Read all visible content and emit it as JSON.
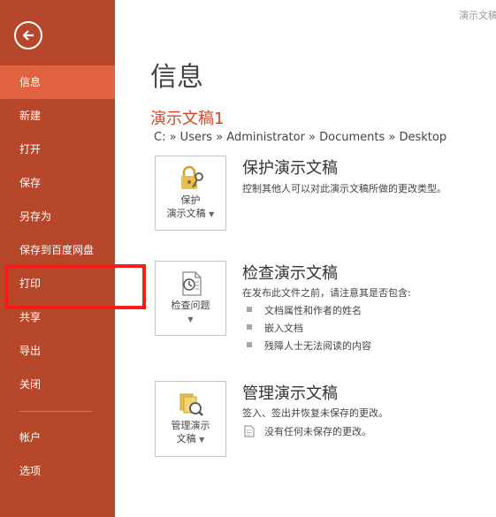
{
  "window": {
    "corner_title": "演示文稿"
  },
  "sidebar": {
    "items": [
      {
        "label": "信息",
        "active": true
      },
      {
        "label": "新建"
      },
      {
        "label": "打开"
      },
      {
        "label": "保存"
      },
      {
        "label": "另存为"
      },
      {
        "label": "保存到百度网盘"
      },
      {
        "label": "打印"
      },
      {
        "label": "共享"
      },
      {
        "label": "导出"
      },
      {
        "label": "关闭"
      },
      {
        "label": "帐户"
      },
      {
        "label": "选项"
      }
    ]
  },
  "main": {
    "page_title": "信息",
    "doc_title": "演示文稿1",
    "path": "C: » Users » Administrator » Documents » Desktop",
    "protect": {
      "tile_line1": "保护",
      "tile_line2": "演示文稿",
      "title": "保护演示文稿",
      "desc": "控制其他人可以对此演示文稿所做的更改类型。"
    },
    "inspect": {
      "tile_line1": "检查问题",
      "title": "检查演示文稿",
      "desc": "在发布此文件之前，请注意其是否包含:",
      "bullets": [
        "文档属性和作者的姓名",
        "嵌入文档",
        "残障人士无法阅读的内容"
      ]
    },
    "manage": {
      "tile_line1": "管理演示",
      "tile_line2": "文稿",
      "title": "管理演示文稿",
      "desc": "签入、签出并恢复未保存的更改。",
      "note": "没有任何未保存的更改。"
    }
  },
  "colors": {
    "sidebar": "#b7472a",
    "active": "#e0623e",
    "accent": "#d24726",
    "highlight": "#ff1a1a"
  }
}
